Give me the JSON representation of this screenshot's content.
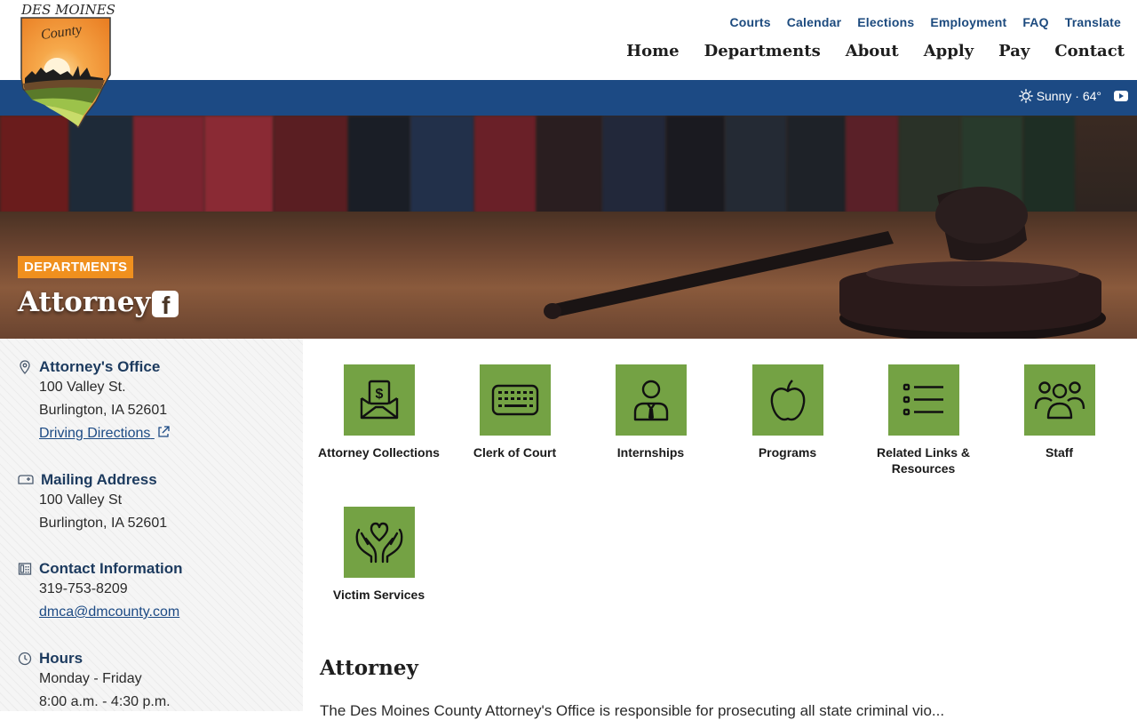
{
  "logo": {
    "title": "DES MOINES",
    "county": "County"
  },
  "util_nav": [
    "Courts",
    "Calendar",
    "Elections",
    "Employment",
    "FAQ",
    "Translate"
  ],
  "main_nav": [
    "Home",
    "Departments",
    "About",
    "Apply",
    "Pay",
    "Contact"
  ],
  "weather": {
    "icon": "sun-icon",
    "text": "Sunny · 64°"
  },
  "hero": {
    "badge": "DEPARTMENTS",
    "title": "Attorney"
  },
  "sidebar": {
    "office": {
      "title": "Attorney's Office",
      "line1": "100 Valley St.",
      "line2": "Burlington, IA 52601",
      "link": "Driving Directions"
    },
    "mailing": {
      "title": "Mailing Address",
      "line1": "100 Valley St",
      "line2": "Burlington, IA 52601"
    },
    "contact": {
      "title": "Contact Information",
      "phone": "319-753-8209",
      "email": "dmca@dmcounty.com"
    },
    "hours": {
      "title": "Hours",
      "line1": "Monday - Friday",
      "line2": "8:00 a.m. - 4:30 p.m."
    }
  },
  "tiles": [
    {
      "label": "Attorney Collections",
      "icon": "money-envelope-icon"
    },
    {
      "label": "Clerk of Court",
      "icon": "keyboard-icon"
    },
    {
      "label": "Internships",
      "icon": "person-tie-icon"
    },
    {
      "label": "Programs",
      "icon": "apple-icon"
    },
    {
      "label": "Related Links & Resources",
      "icon": "list-icon"
    },
    {
      "label": "Staff",
      "icon": "group-icon"
    },
    {
      "label": "Victim Services",
      "icon": "heart-hands-icon"
    }
  ],
  "page": {
    "heading": "Attorney",
    "intro": "The Des Moines County Attorney's Office is responsible for prosecuting all state criminal vio..."
  },
  "colors": {
    "brand_blue": "#1c4a84",
    "accent_orange": "#f0901e",
    "tile_green": "#74a244"
  }
}
